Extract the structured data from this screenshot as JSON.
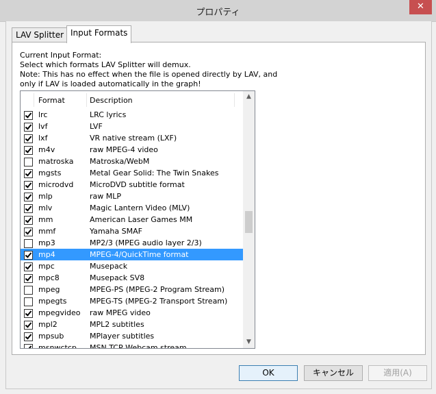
{
  "window": {
    "title": "プロパティ",
    "close_glyph": "✕"
  },
  "tabs": [
    {
      "label": "LAV Splitter",
      "active": false
    },
    {
      "label": "Input Formats",
      "active": true
    }
  ],
  "info": {
    "line1": "Current Input Format:",
    "line2": "Select which formats LAV Splitter will demux.",
    "line3": "Note: This has no effect when the file is opened directly by LAV, and",
    "line4": "only if LAV is loaded automatically in the graph!"
  },
  "list": {
    "headers": {
      "format": "Format",
      "description": "Description"
    },
    "rows": [
      {
        "format": "lrc",
        "description": "LRC lyrics",
        "checked": true
      },
      {
        "format": "lvf",
        "description": "LVF",
        "checked": true
      },
      {
        "format": "lxf",
        "description": "VR native stream (LXF)",
        "checked": true
      },
      {
        "format": "m4v",
        "description": "raw MPEG-4 video",
        "checked": true
      },
      {
        "format": "matroska",
        "description": "Matroska/WebM",
        "checked": false
      },
      {
        "format": "mgsts",
        "description": "Metal Gear Solid: The Twin Snakes",
        "checked": true
      },
      {
        "format": "microdvd",
        "description": "MicroDVD subtitle format",
        "checked": true
      },
      {
        "format": "mlp",
        "description": "raw MLP",
        "checked": true
      },
      {
        "format": "mlv",
        "description": "Magic Lantern Video (MLV)",
        "checked": true
      },
      {
        "format": "mm",
        "description": "American Laser Games MM",
        "checked": true
      },
      {
        "format": "mmf",
        "description": "Yamaha SMAF",
        "checked": true
      },
      {
        "format": "mp3",
        "description": "MP2/3 (MPEG audio layer 2/3)",
        "checked": false
      },
      {
        "format": "mp4",
        "description": "MPEG-4/QuickTime format",
        "checked": true,
        "selected": true
      },
      {
        "format": "mpc",
        "description": "Musepack",
        "checked": true
      },
      {
        "format": "mpc8",
        "description": "Musepack SV8",
        "checked": true
      },
      {
        "format": "mpeg",
        "description": "MPEG-PS (MPEG-2 Program Stream)",
        "checked": false
      },
      {
        "format": "mpegts",
        "description": "MPEG-TS (MPEG-2 Transport Stream)",
        "checked": false
      },
      {
        "format": "mpegvideo",
        "description": "raw MPEG video",
        "checked": true
      },
      {
        "format": "mpl2",
        "description": "MPL2 subtitles",
        "checked": true
      },
      {
        "format": "mpsub",
        "description": "MPlayer subtitles",
        "checked": true
      },
      {
        "format": "msnwctcp",
        "description": "MSN TCP Webcam stream",
        "checked": true
      }
    ],
    "scrollbar": {
      "up_glyph": "▲",
      "down_glyph": "▼"
    }
  },
  "buttons": {
    "ok": "OK",
    "cancel": "キャンセル",
    "apply": "適用(A)"
  }
}
